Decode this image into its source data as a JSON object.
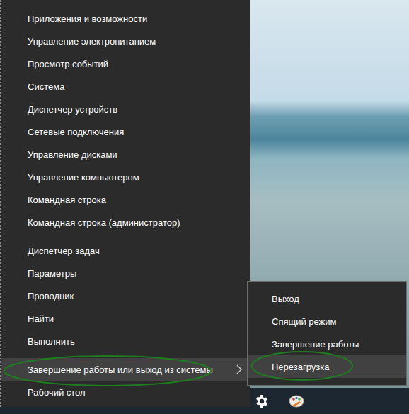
{
  "menu": {
    "groups": [
      {
        "items": [
          {
            "label": "Приложения и возможности",
            "selected": false,
            "has_submenu": false
          },
          {
            "label": "Управление электропитанием",
            "selected": false,
            "has_submenu": false
          },
          {
            "label": "Просмотр событий",
            "selected": false,
            "has_submenu": false
          },
          {
            "label": "Система",
            "selected": false,
            "has_submenu": false
          },
          {
            "label": "Диспетчер устройств",
            "selected": false,
            "has_submenu": false
          },
          {
            "label": "Сетевые подключения",
            "selected": false,
            "has_submenu": false
          },
          {
            "label": "Управление дисками",
            "selected": false,
            "has_submenu": false
          },
          {
            "label": "Управление компьютером",
            "selected": false,
            "has_submenu": false
          },
          {
            "label": "Командная строка",
            "selected": false,
            "has_submenu": false
          },
          {
            "label": "Командная строка (администратор)",
            "selected": false,
            "has_submenu": false
          }
        ]
      },
      {
        "items": [
          {
            "label": "Диспетчер задач",
            "selected": false,
            "has_submenu": false
          },
          {
            "label": "Параметры",
            "selected": false,
            "has_submenu": false
          },
          {
            "label": "Проводник",
            "selected": false,
            "has_submenu": false
          },
          {
            "label": "Найти",
            "selected": false,
            "has_submenu": false
          },
          {
            "label": "Выполнить",
            "selected": false,
            "has_submenu": false
          }
        ]
      },
      {
        "items": [
          {
            "label": "Завершение работы или выход из системы",
            "selected": true,
            "has_submenu": true
          },
          {
            "label": "Рабочий стол",
            "selected": false,
            "has_submenu": false
          }
        ]
      }
    ]
  },
  "submenu": {
    "items": [
      {
        "label": "Выход",
        "selected": false
      },
      {
        "label": "Спящий режим",
        "selected": false
      },
      {
        "label": "Завершение работы",
        "selected": false
      },
      {
        "label": "Перезагрузка",
        "selected": true
      }
    ]
  }
}
